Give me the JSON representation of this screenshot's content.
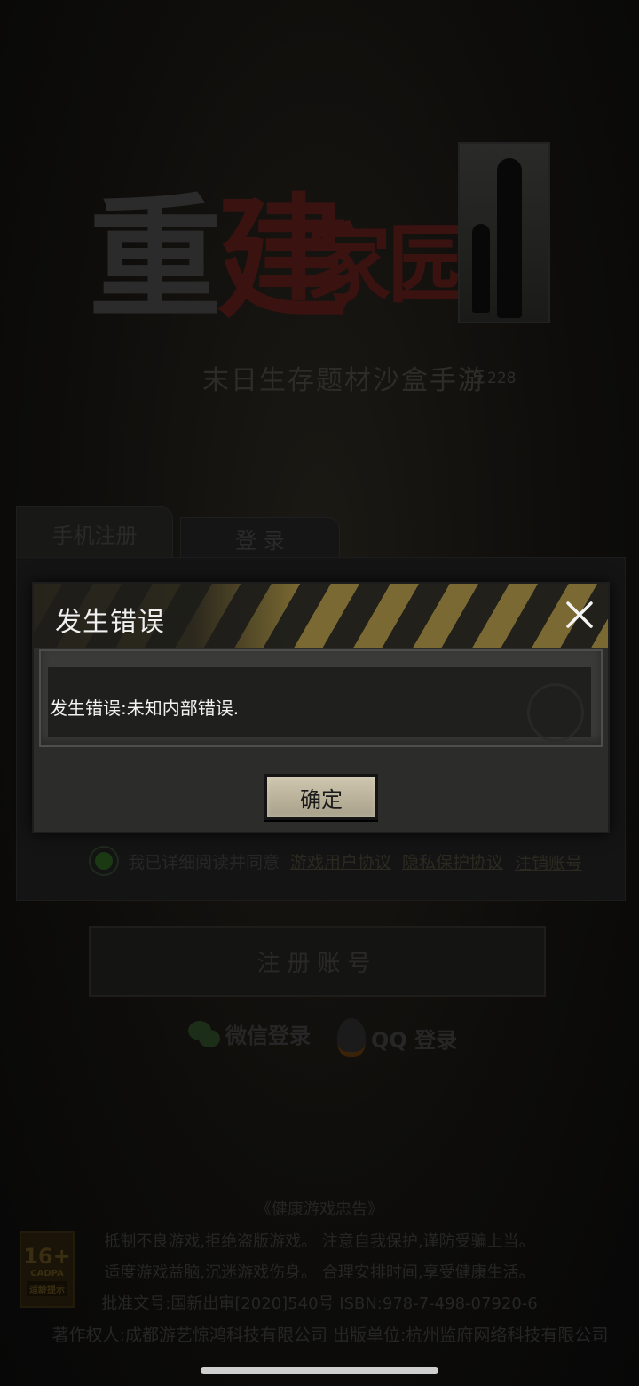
{
  "game": {
    "logo_char1": "重",
    "logo_char2": "建",
    "logo_rest": "家园",
    "subtitle": "末日生存题材沙盒手游",
    "version": "19.228"
  },
  "tabs": {
    "phone_register": "手机注册",
    "login": "登 录"
  },
  "agreement": {
    "prefix": "我已详细阅读并同意",
    "user_agreement": "游戏用户协议",
    "privacy_agreement": "隐私保护协议",
    "cancel_account": "注销账号"
  },
  "register_button": "注册账号",
  "social": {
    "wechat": "微信登录",
    "qq": "QQ 登录"
  },
  "notice": {
    "title": "《健康游戏忠告》",
    "line1": "抵制不良游戏,拒绝盗版游戏。 注意自我保护,谨防受骗上当。",
    "line2": "适度游戏益脑,沉迷游戏伤身。 合理安排时间,享受健康生活。",
    "line3": "批准文号:国新出审[2020]540号    ISBN:978-7-498-07920-6",
    "copyright": "著作权人:成都游艺惊鸿科技有限公司 出版单位:杭州监府网络科技有限公司"
  },
  "age_rating": {
    "age": "16+",
    "org": "CADPA",
    "tip": "适龄提示"
  },
  "dialog": {
    "title": "发生错误",
    "message": "发生错误:未知内部错误.",
    "confirm": "确定"
  }
}
